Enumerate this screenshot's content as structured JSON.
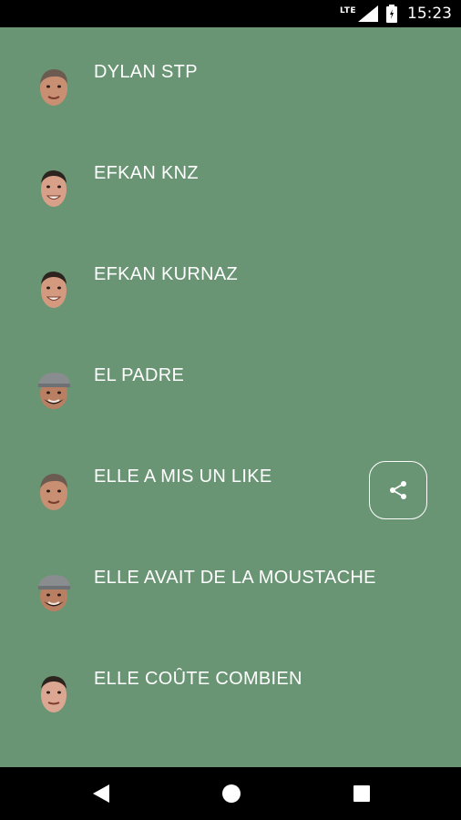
{
  "status_bar": {
    "network": "LTE",
    "time": "15:23"
  },
  "list": {
    "items": [
      {
        "label": "DYLAN STP",
        "avatar": "face-avatar-icon"
      },
      {
        "label": "EFKAN KNZ",
        "avatar": "face-avatar-icon"
      },
      {
        "label": "EFKAN KURNAZ",
        "avatar": "face-avatar-icon"
      },
      {
        "label": "EL PADRE",
        "avatar": "face-cap-avatar-icon"
      },
      {
        "label": "ELLE A MIS UN LIKE",
        "avatar": "face-avatar-icon"
      },
      {
        "label": "ELLE AVAIT DE LA MOUSTACHE",
        "avatar": "face-cap-avatar-icon"
      },
      {
        "label": "ELLE COÛTE COMBIEN",
        "avatar": "face-avatar-icon"
      }
    ]
  },
  "share_button": {
    "icon": "share-icon"
  },
  "nav_bar": {
    "back": "back-icon",
    "home": "home-icon",
    "recents": "recents-icon"
  },
  "colors": {
    "background": "#6a9574",
    "text": "#ffffff",
    "bars": "#000000"
  }
}
